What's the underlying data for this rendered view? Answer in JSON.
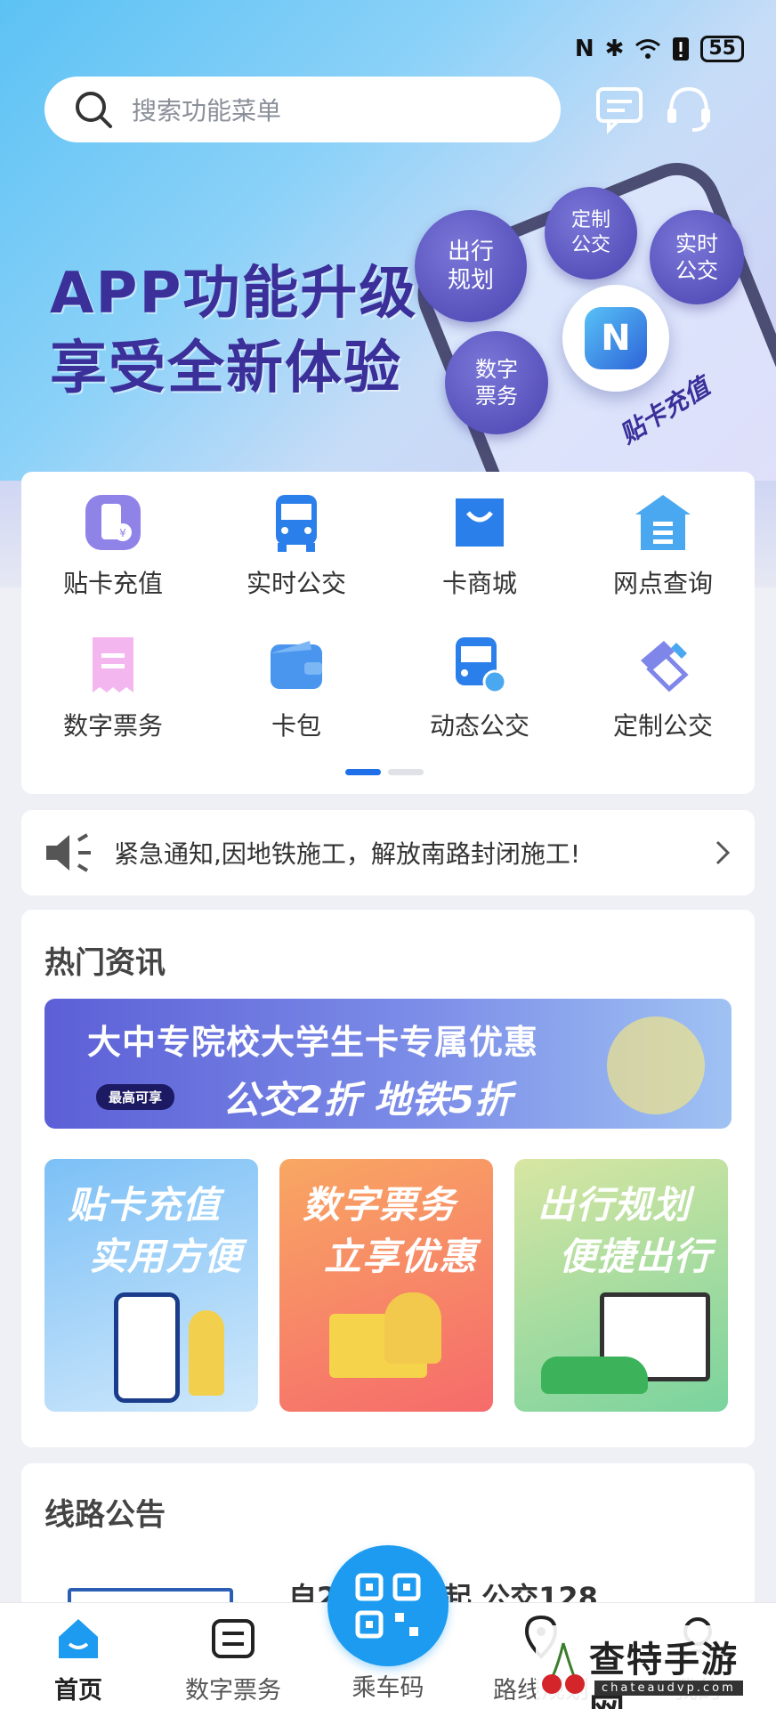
{
  "status_bar": {
    "battery": "55"
  },
  "search": {
    "placeholder": "搜索功能菜单"
  },
  "banner": {
    "title_line1": "APP功能升级",
    "title_line2": "享受全新体验",
    "bubbles": [
      "出行规划",
      "定制公交",
      "实时公交",
      "数字票务"
    ],
    "nfc_label": "贴卡充值"
  },
  "functions": [
    {
      "label": "贴卡充值",
      "icon": "nfc-card-icon"
    },
    {
      "label": "实时公交",
      "icon": "bus-icon"
    },
    {
      "label": "卡商城",
      "icon": "shopping-bag-icon"
    },
    {
      "label": "网点查询",
      "icon": "outlet-icon"
    },
    {
      "label": "数字票务",
      "icon": "ticket-icon"
    },
    {
      "label": "卡包",
      "icon": "wallet-icon"
    },
    {
      "label": "动态公交",
      "icon": "dynamic-bus-icon"
    },
    {
      "label": "定制公交",
      "icon": "custom-route-icon"
    }
  ],
  "notice": {
    "text": "紧急通知,因地铁施工，解放南路封闭施工!"
  },
  "news": {
    "title": "热门资讯",
    "promo": {
      "line1": "大中专院校大学生卡专属优惠",
      "pill": "最高可享",
      "line2": "公交2折  地铁5折"
    },
    "tiles": [
      {
        "line1": "贴卡充值",
        "line2": "实用方便"
      },
      {
        "line1": "数字票务",
        "line2": "立享优惠"
      },
      {
        "line1": "出行规划",
        "line2": "便捷出行"
      }
    ]
  },
  "routes": {
    "title": "线路公告",
    "preview": "自2   月28日起  公交128"
  },
  "bottom_nav": {
    "home": "首页",
    "tickets": "数字票务",
    "qr": "乘车码",
    "route": "路线规划",
    "mine": "我的"
  },
  "watermark": {
    "text": "查特手游网",
    "sub": "chateaudvp.com"
  },
  "colors": {
    "accent": "#1c9bf0",
    "brand_purple": "#3b2f9a"
  }
}
